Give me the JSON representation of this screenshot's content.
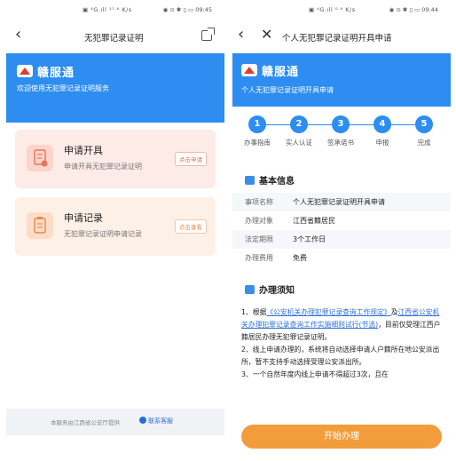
{
  "left_screen": {
    "status": {
      "signal": "▣ ⁴G.ıll  ¹⁷·⁶ K/s",
      "icons": "◉ ⊙ ✱ ▯ ▭ 09:45"
    },
    "nav_title": "无犯罪记录证明",
    "brand": "赣服通",
    "welcome": "欢迎使用无犯罪记录证明服务",
    "cards": [
      {
        "title": "申请开具",
        "subtitle": "申请开具无犯罪记录证明",
        "button": "点击申请"
      },
      {
        "title": "申请记录",
        "subtitle": "无犯罪记录证明申请记录",
        "button": "点击查看"
      }
    ],
    "footer_text": "本服务由江西省公安厅提供",
    "footer_link": "联系客服"
  },
  "right_screen": {
    "status": {
      "signal": "▣ ⁴G.ıll  ⁰·⁹ K/s",
      "icons": "◉ ⊙ ✱ ▯ ▭ 09:44"
    },
    "nav_title": "个人无犯罪记录证明开具申请",
    "brand": "赣服通",
    "subtitle": "个人无犯罪记录证明开具申请",
    "steps": [
      {
        "num": "1",
        "label": "办事指南"
      },
      {
        "num": "2",
        "label": "实人认证"
      },
      {
        "num": "3",
        "label": "签承诺书"
      },
      {
        "num": "4",
        "label": "申报"
      },
      {
        "num": "5",
        "label": "完成"
      }
    ],
    "basic_info_title": "基本信息",
    "info_rows": [
      {
        "key": "事项名称",
        "value": "个人无犯罪记录证明开具申请"
      },
      {
        "key": "办理对象",
        "value": "江西省籍居民"
      },
      {
        "key": "法定期限",
        "value": "3个工作日"
      },
      {
        "key": "办理费用",
        "value": "免费"
      }
    ],
    "notes_title": "办理须知",
    "notes": {
      "p1_prefix": "1、根据",
      "p1_link1": "《公安机关办理犯罪记录查询工作规定》",
      "p1_mid": "及",
      "p1_link2": "江西省公安机关办理犯罪记录查询工作实施细则试行(节选)",
      "p1_suffix": "，目前仅受理江西户籍居民办理无犯罪记录证明。",
      "p2": "2、线上申请办理的，系统将自动选择申请人户籍所在地公安派出所，暂不支持手动选择受理公安派出所。",
      "p3": "3、一个自然年度内线上申请不得超过3次，且在"
    },
    "start_button": "开始办理"
  },
  "colors": {
    "primary_blue": "#2d8df0",
    "orange": "#f39c3c",
    "logo_red": "#e23a2e"
  }
}
